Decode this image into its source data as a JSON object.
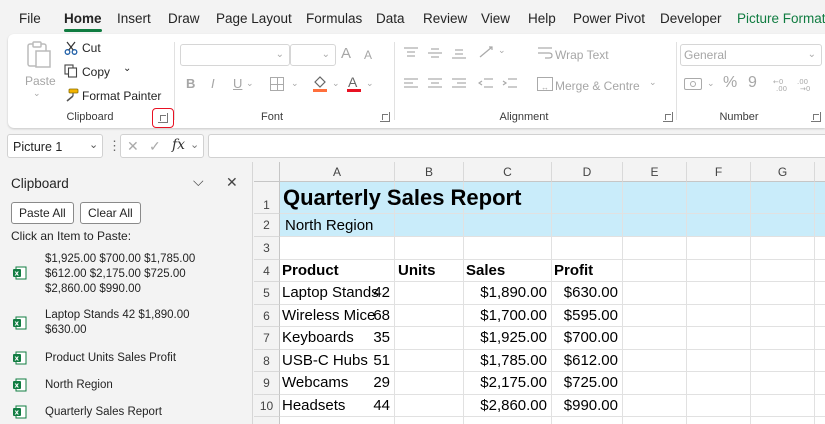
{
  "menu": {
    "tabs": [
      "File",
      "Home",
      "Insert",
      "Draw",
      "Page Layout",
      "Formulas",
      "Data",
      "Review",
      "View",
      "Help",
      "Power Pivot",
      "Developer",
      "Picture Format"
    ],
    "active": "Home"
  },
  "ribbon": {
    "clipboard": {
      "paste": "Paste",
      "cut": "Cut",
      "copy": "Copy",
      "format_painter": "Format Painter",
      "group_label": "Clipboard"
    },
    "font": {
      "group_label": "Font",
      "grow_glyph": "A",
      "shrink_glyph": "A",
      "bold": "B",
      "italic": "I",
      "underline": "U",
      "font_color_glyph": "A"
    },
    "alignment": {
      "wrap_text": "Wrap Text",
      "merge_centre": "Merge & Centre",
      "group_label": "Alignment"
    },
    "number": {
      "format_value": "General",
      "percent": "%",
      "comma": "9",
      "group_label": "Number"
    }
  },
  "formula_bar": {
    "name_box": "Picture 1",
    "fx": "fx",
    "formula": ""
  },
  "clipboard_pane": {
    "title": "Clipboard",
    "paste_all": "Paste All",
    "clear_all": "Clear All",
    "instruction": "Click an Item to Paste:",
    "items": [
      {
        "lines": [
          "$1,925.00 $700.00 $1,785.00",
          "$612.00 $2,175.00 $725.00",
          "$2,860.00 $990.00"
        ]
      },
      {
        "lines": [
          "Laptop Stands 42 $1,890.00",
          "$630.00"
        ]
      },
      {
        "lines": [
          "Product Units Sales Profit"
        ]
      },
      {
        "lines": [
          "North Region"
        ]
      },
      {
        "lines": [
          "Quarterly Sales Report"
        ]
      }
    ]
  },
  "sheet": {
    "columns": [
      "A",
      "B",
      "C",
      "D",
      "E",
      "F",
      "G"
    ],
    "rows": [
      "1",
      "2",
      "3",
      "4",
      "5",
      "6",
      "7",
      "8",
      "9",
      "10"
    ],
    "title": "Quarterly Sales Report",
    "subtitle": "North Region",
    "headers": [
      "Product",
      "Units",
      "Sales",
      "Profit"
    ],
    "data": [
      [
        "Laptop Stands",
        "42",
        "$1,890.00",
        "$630.00"
      ],
      [
        "Wireless Mice",
        "68",
        "$1,700.00",
        "$595.00"
      ],
      [
        "Keyboards",
        "35",
        "$1,925.00",
        "$700.00"
      ],
      [
        "USB-C Hubs",
        "51",
        "$1,785.00",
        "$612.00"
      ],
      [
        "Webcams",
        "29",
        "$2,175.00",
        "$725.00"
      ],
      [
        "Headsets",
        "44",
        "$2,860.00",
        "$990.00"
      ]
    ]
  },
  "colors": {
    "accent_green": "#107c41",
    "title_fill": "#c9ecfa",
    "highlight_red": "#e81123"
  }
}
